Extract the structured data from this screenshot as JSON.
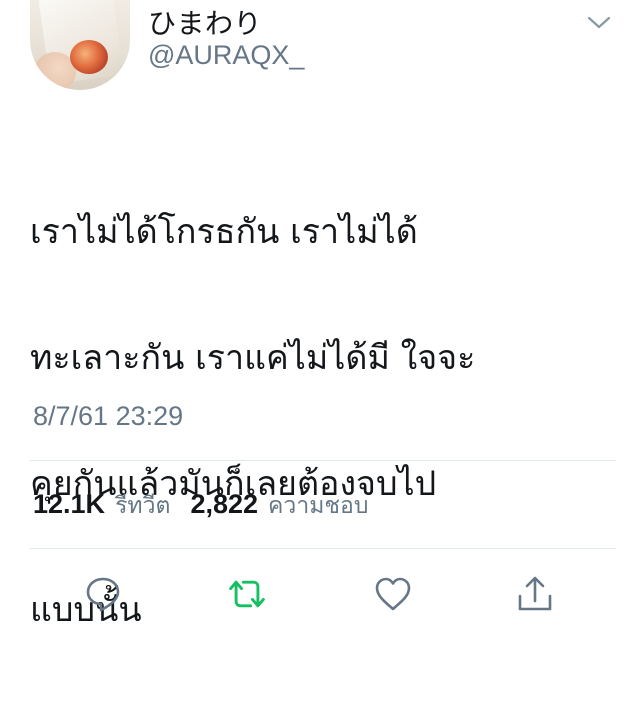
{
  "user": {
    "display_name": "ひまわり",
    "handle": "@AURAQX_"
  },
  "tweet": {
    "text_lines": [
      "เราไม่ได้โกรธกัน เราไม่ได้",
      "ทะเลาะกัน เราแค่ไม่ได้มี ใจจะ",
      "คุยกันแล้วมันก็เลยต้องจบไป",
      "แบบนั้น"
    ],
    "timestamp": "8/7/61 23:29"
  },
  "stats": {
    "retweets_count": "12.1K",
    "retweets_label": "รีทวีต",
    "likes_count": "2,822",
    "likes_label": "ความชอบ"
  },
  "icons": {
    "menu": "chevron-down-icon",
    "reply": "reply-icon",
    "retweet": "retweet-icon",
    "like": "heart-icon",
    "share": "share-icon"
  },
  "colors": {
    "text": "#14171a",
    "secondary": "#657786",
    "retweet_active": "#17bf63",
    "divider": "#e1e8ed"
  }
}
